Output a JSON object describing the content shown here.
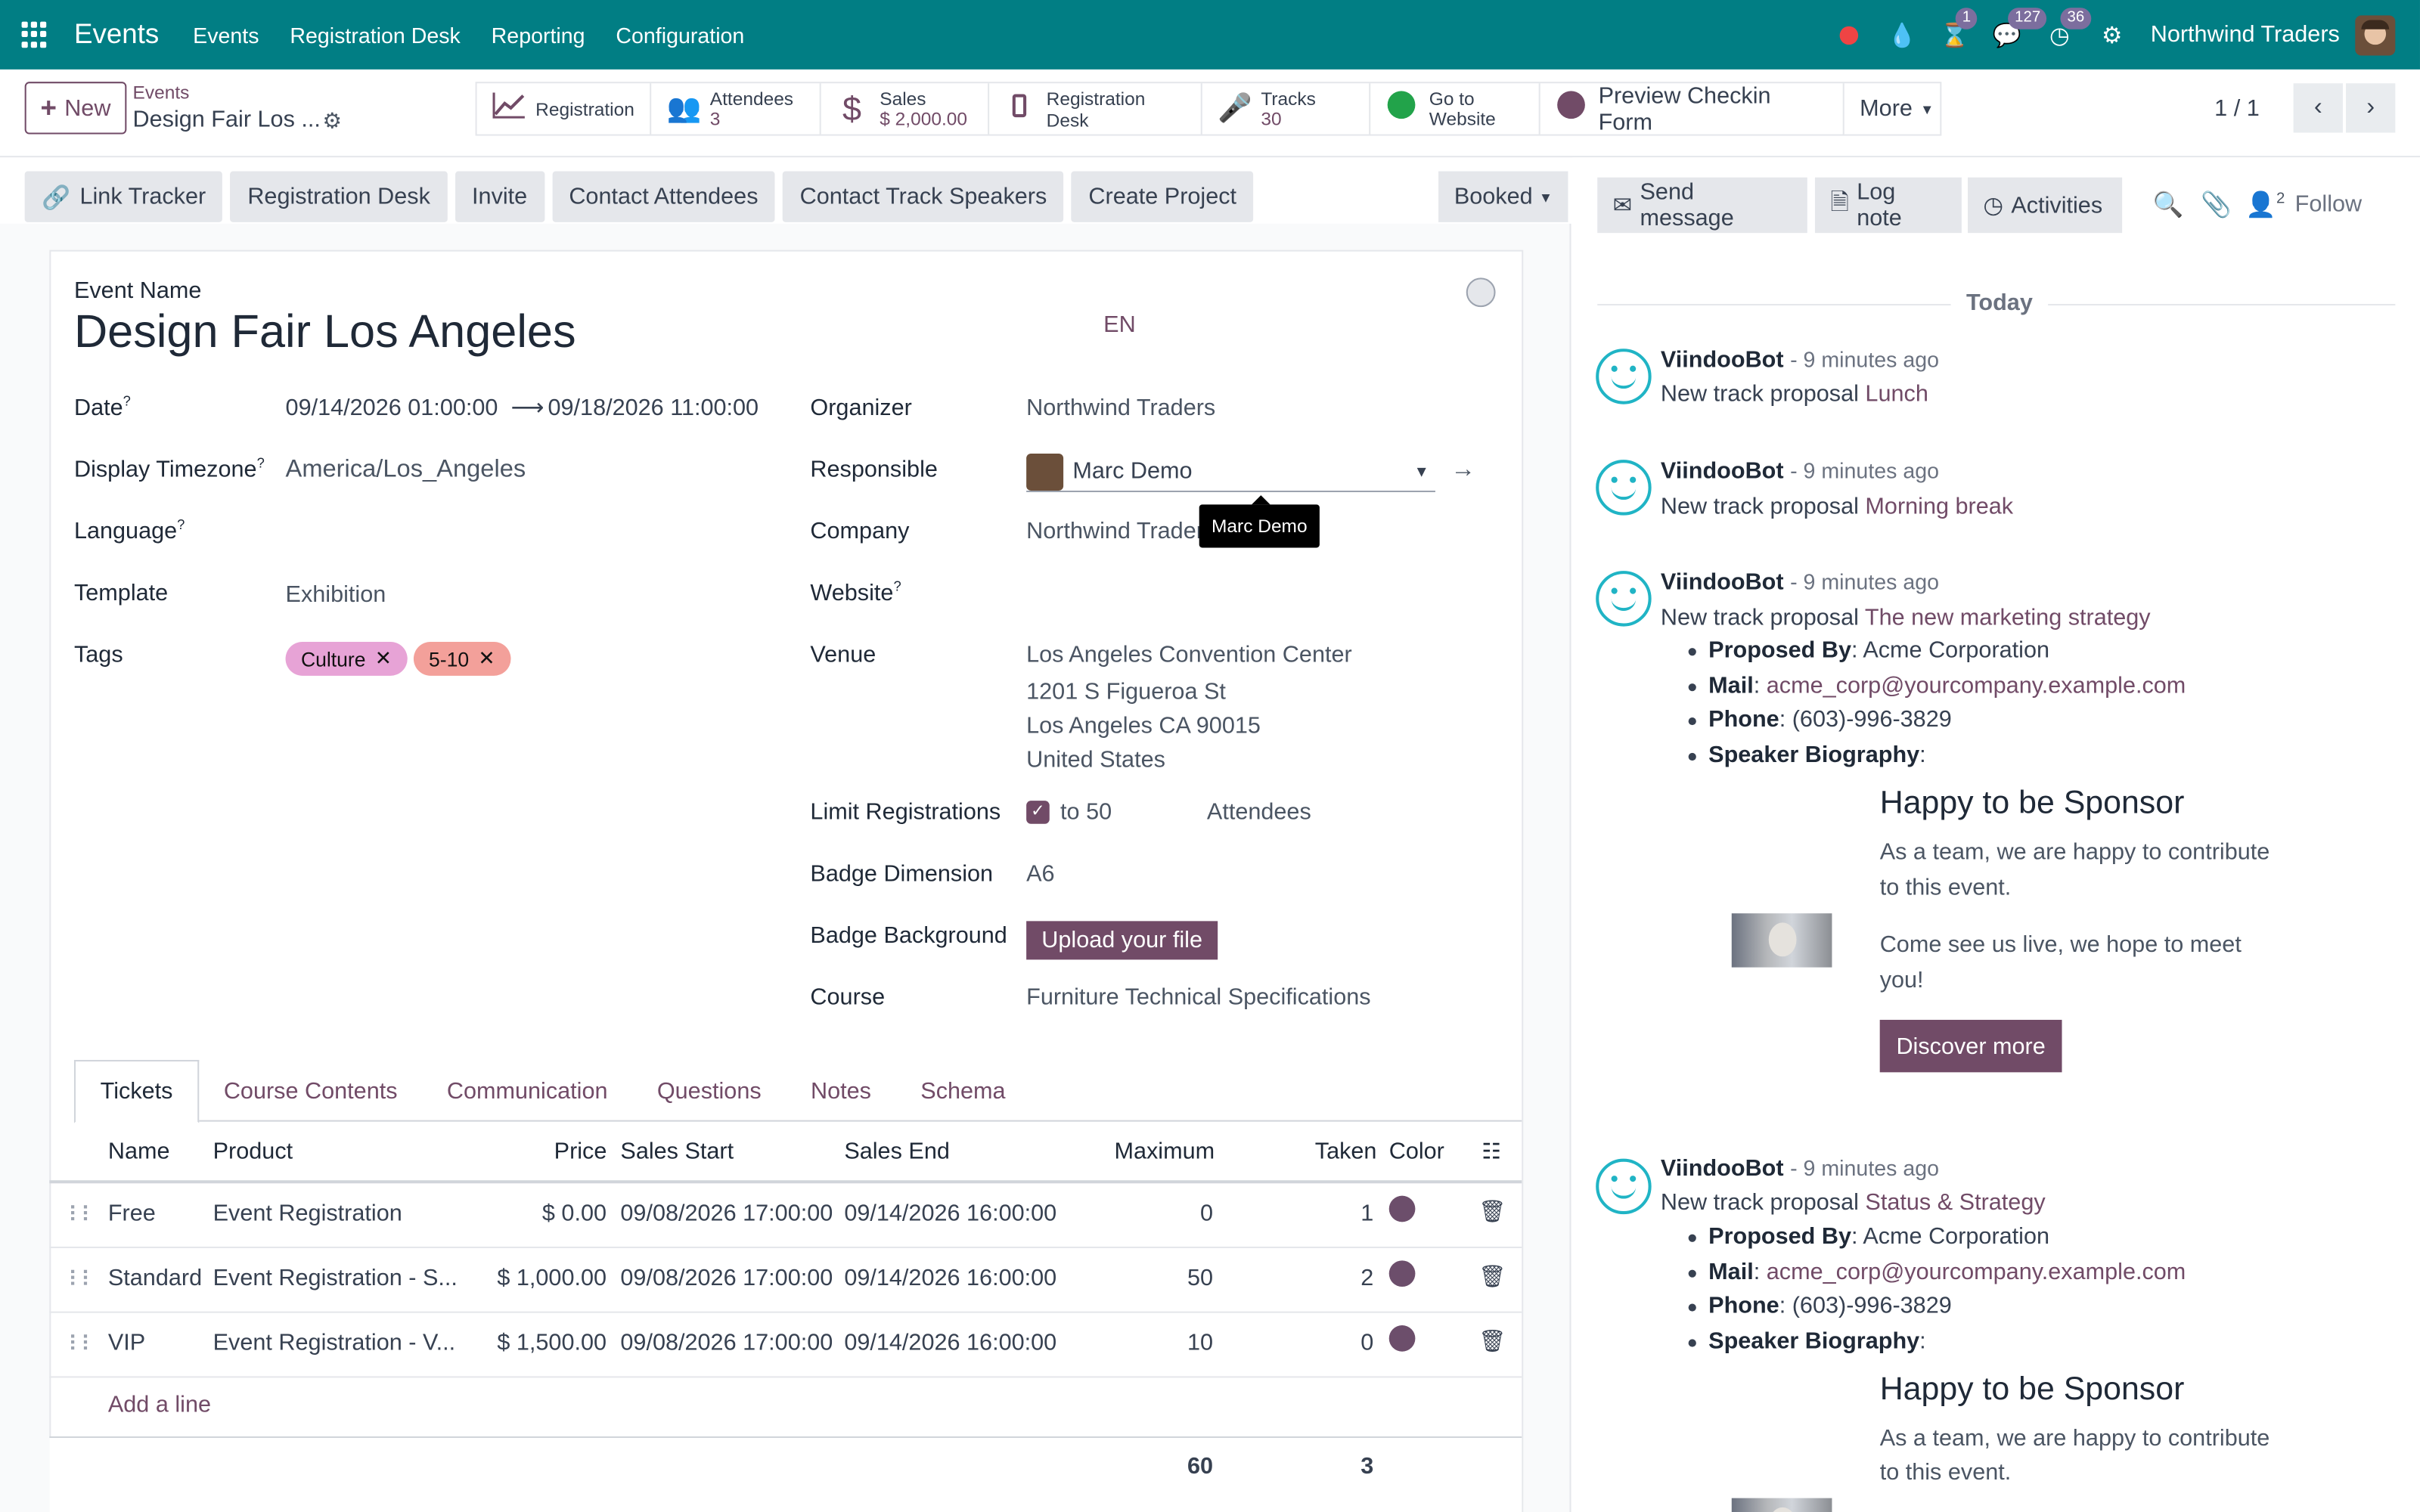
{
  "topnav": {
    "app_name": "Events",
    "menus": [
      "Events",
      "Registration Desk",
      "Reporting",
      "Configuration"
    ],
    "badges": {
      "activities": "1",
      "messages": "127",
      "clock": "36"
    },
    "company": "Northwind Traders"
  },
  "control": {
    "new_label": "New",
    "breadcrumb_parent": "Events",
    "breadcrumb_current": "Design Fair Los ...",
    "smart_buttons": {
      "registration": "Registration",
      "attendees_label": "Attendees",
      "attendees_value": "3",
      "sales_label": "Sales",
      "sales_value": "$ 2,000.00",
      "registration_desk": "Registration Desk",
      "tracks_label": "Tracks",
      "tracks_value": "30",
      "goto_line1": "Go to",
      "goto_line2": "Website",
      "preview": "Preview Checkin Form",
      "more": "More"
    },
    "pager": "1 / 1"
  },
  "statusbar": {
    "actions": [
      "Link Tracker",
      "Registration Desk",
      "Invite",
      "Contact Attendees",
      "Contact Track Speakers",
      "Create Project"
    ],
    "stage": "Booked"
  },
  "form": {
    "event_name_label": "Event Name",
    "event_name": "Design Fair Los Angeles",
    "lang": "EN",
    "labels": {
      "date": "Date",
      "timezone": "Display Timezone",
      "language": "Language",
      "template": "Template",
      "tags": "Tags",
      "organizer": "Organizer",
      "responsible": "Responsible",
      "company": "Company",
      "website": "Website",
      "venue": "Venue",
      "limit": "Limit Registrations",
      "badge_dim": "Badge Dimension",
      "badge_bg": "Badge Background",
      "course": "Course"
    },
    "values": {
      "date_start": "09/14/2026 01:00:00",
      "date_end": "09/18/2026 11:00:00",
      "timezone": "America/Los_Angeles",
      "template": "Exhibition",
      "organizer": "Northwind Traders",
      "responsible": "Marc Demo",
      "company": "Northwind Traders",
      "venue_line1": "Los Angeles Convention Center",
      "venue_line2": "1201 S Figueroa St",
      "venue_line3": "Los Angeles CA 90015",
      "venue_line4": "United States",
      "limit_to": "to 50",
      "limit_unit": "Attendees",
      "badge_dim": "A6",
      "upload": "Upload your file",
      "course": "Furniture Technical Specifications"
    },
    "tags": [
      {
        "label": "Culture",
        "color": "#e7a3d6"
      },
      {
        "label": "5-10",
        "color": "#f3a09a"
      }
    ],
    "tooltip": "Marc Demo"
  },
  "tabs": [
    "Tickets",
    "Course Contents",
    "Communication",
    "Questions",
    "Notes",
    "Schema"
  ],
  "tickets": {
    "headers": [
      "Name",
      "Product",
      "Price",
      "Sales Start",
      "Sales End",
      "Maximum",
      "Taken",
      "Color"
    ],
    "rows": [
      {
        "name": "Free",
        "product": "Event Registration",
        "price": "$ 0.00",
        "start": "09/08/2026 17:00:00",
        "end": "09/14/2026 16:00:00",
        "max": "0",
        "taken": "1"
      },
      {
        "name": "Standard",
        "product": "Event Registration - S...",
        "price": "$ 1,000.00",
        "start": "09/08/2026 17:00:00",
        "end": "09/14/2026 16:00:00",
        "max": "50",
        "taken": "2"
      },
      {
        "name": "VIP",
        "product": "Event Registration - V...",
        "price": "$ 1,500.00",
        "start": "09/08/2026 17:00:00",
        "end": "09/14/2026 16:00:00",
        "max": "10",
        "taken": "0"
      }
    ],
    "add_line": "Add a line",
    "total_max": "60",
    "total_taken": "3"
  },
  "chatter": {
    "send_message": "Send message",
    "log_note": "Log note",
    "activities": "Activities",
    "followers_count": "2",
    "follow": "Follow",
    "today": "Today",
    "author": "ViindooBot",
    "ago": "- 9 minutes ago",
    "prefix": "New track proposal",
    "messages": [
      "Lunch",
      "Morning break",
      "The new marketing strategy",
      "Status & Strategy"
    ],
    "details": {
      "proposed_label": "Proposed By",
      "proposed": ": Acme Corporation",
      "mail_label": "Mail",
      "mail": "acme_corp@yourcompany.example.com",
      "phone_label": "Phone",
      "phone": ": (603)-996-3829",
      "bio_label": "Speaker Biography"
    },
    "sponsor": {
      "title": "Happy to be Sponsor",
      "text1_a": "As a team, we are happy to contribute",
      "text1_b": "to this event.",
      "text2_a": "Come see us live, we hope to meet",
      "text2_b": "you!",
      "discover": "Discover more"
    }
  }
}
